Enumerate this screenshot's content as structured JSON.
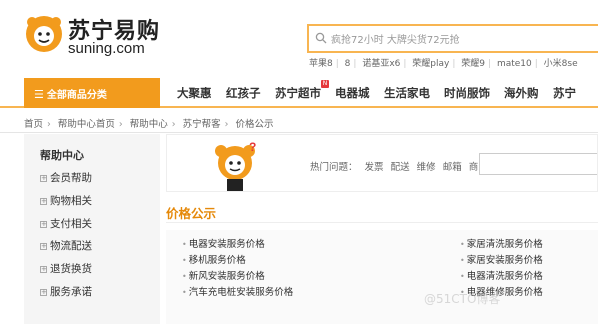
{
  "header": {
    "logo_cn": "苏宁易购",
    "logo_en": "suning.com",
    "search_placeholder": "疯抢72小时 大牌尖货72元抢",
    "hotwords": [
      "苹果8",
      "8",
      "诺基亚x6",
      "荣耀play",
      "荣耀9",
      "mate10",
      "小米8se"
    ]
  },
  "nav": {
    "all_categories": "全部商品分类",
    "items": [
      "大聚惠",
      "红孩子",
      "苏宁超市",
      "电器城",
      "生活家电",
      "时尚服饰",
      "海外购",
      "苏宁"
    ]
  },
  "breadcrumb": [
    "首页",
    "帮助中心首页",
    "帮助中心",
    "苏宁帮客",
    "价格公示"
  ],
  "sidebar": {
    "title": "帮助中心",
    "items": [
      "会员帮助",
      "购物相关",
      "支付相关",
      "物流配送",
      "退货换货",
      "服务承诺"
    ]
  },
  "main": {
    "hot_label": "热门问题：",
    "hot_items": [
      "发票",
      "配送",
      "维修",
      "邮箱",
      "商家"
    ],
    "section_title": "价格公示",
    "left_items": [
      "电器安装服务价格",
      "移机服务价格",
      "新风安装服务价格",
      "汽车充电桩安装服务价格"
    ],
    "right_items": [
      "家居清洗服务价格",
      "家居安装服务价格",
      "电器清洗服务价格",
      "电器维修服务价格"
    ]
  },
  "watermark": "@51CTO博客"
}
